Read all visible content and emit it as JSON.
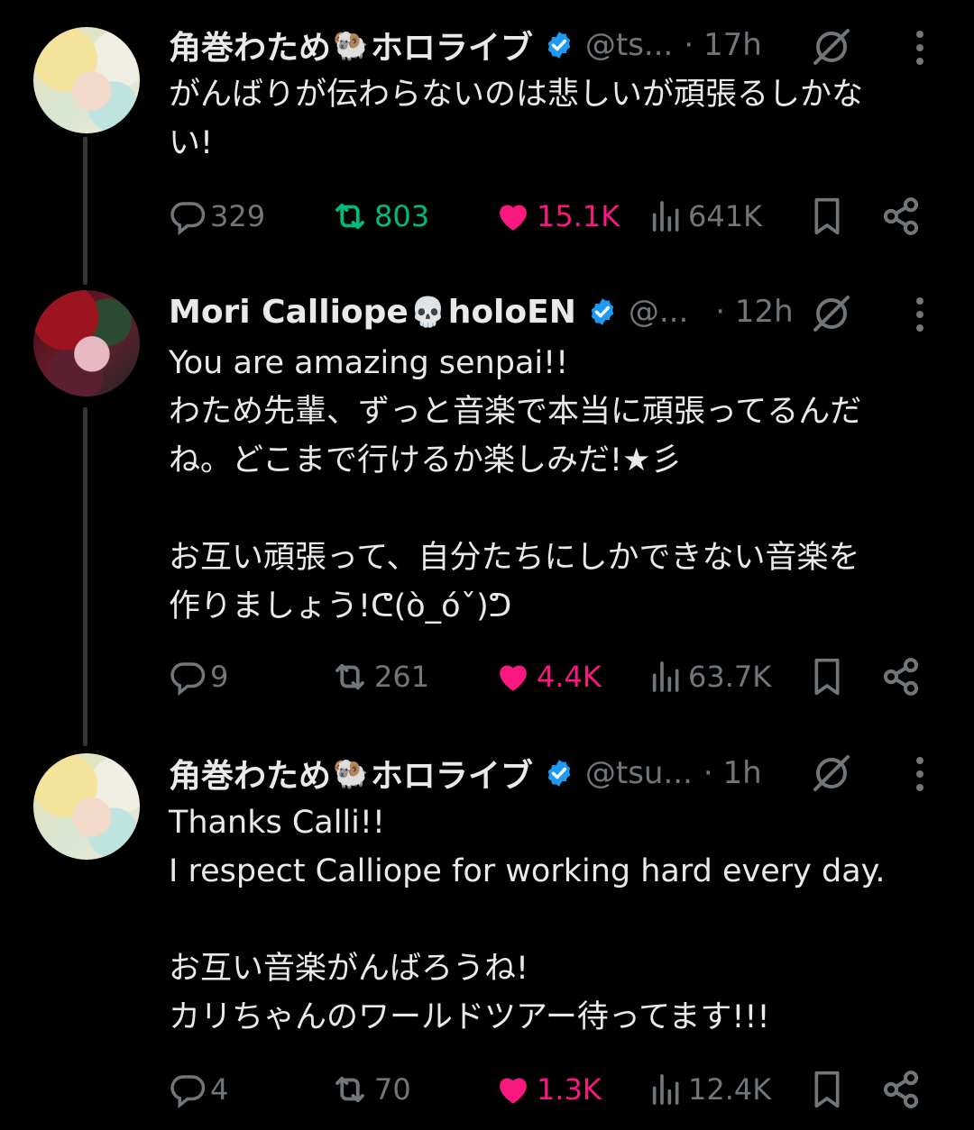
{
  "colors": {
    "background": "#000000",
    "text": "#e7e9ea",
    "muted": "#71767b",
    "verified": "#1d9bf0",
    "retweet": "#00ba7c",
    "like": "#f91880"
  },
  "tweets": [
    {
      "name": "角巻わため",
      "emoji": "🐏",
      "name_suffix": "ホロライブ",
      "handle": "@ts...",
      "time": "· 17h",
      "lines": [
        "がんばりが伝わらないのは悲しいが頑張るしかな",
        "い!"
      ],
      "replies": "329",
      "reposts": "803",
      "likes": "15.1K",
      "views": "641K",
      "retweeted": true,
      "liked": true,
      "icons": [
        "reply-icon",
        "repost-icon",
        "heart-icon",
        "views-icon",
        "bookmark-icon",
        "share-icon"
      ]
    },
    {
      "name": "Mori Calliope",
      "emoji": "💀",
      "name_suffix": "holoEN",
      "handle": "@...",
      "time": "· 12h",
      "lines": [
        "You are amazing senpai!!",
        "わため先輩、ずっと音楽で本当に頑張ってるんだ",
        "ね。どこまで行けるか楽しみだ!★彡",
        "",
        "お互い頑張って、自分たちにしかできない音楽を",
        "作りましょう!ᕦ(ò_óˇ)ᕤ"
      ],
      "replies": "9",
      "reposts": "261",
      "likes": "4.4K",
      "views": "63.7K",
      "retweeted": false,
      "liked": true
    },
    {
      "name": "角巻わため",
      "emoji": "🐏",
      "name_suffix": "ホロライブ",
      "handle": "@tsu...",
      "time": "· 1h",
      "lines": [
        "Thanks Calli!!",
        "I respect Calliope for working hard every day.",
        "",
        "お互い音楽がんばろうね!",
        "カリちゃんのワールドツアー待ってます!!!"
      ],
      "replies": "4",
      "reposts": "70",
      "likes": "1.3K",
      "views": "12.4K",
      "retweeted": false,
      "liked": true
    }
  ]
}
